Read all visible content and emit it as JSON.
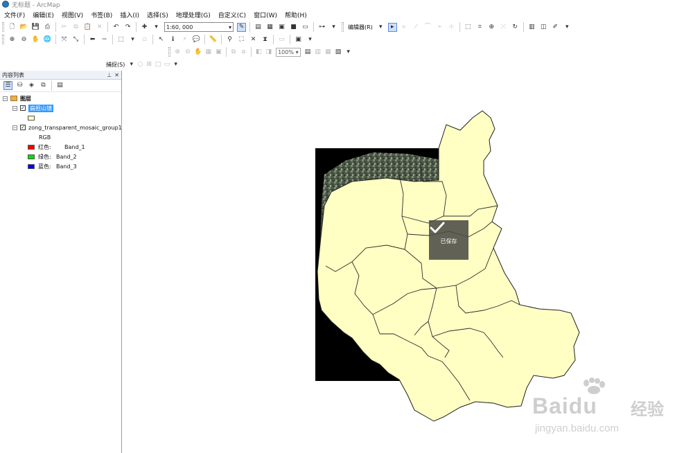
{
  "window": {
    "title": "无标题 - ArcMap"
  },
  "menu": [
    "文件(F)",
    "编辑(E)",
    "视图(V)",
    "书签(B)",
    "插入(I)",
    "选择(S)",
    "地理处理(G)",
    "自定义(C)",
    "窗口(W)",
    "帮助(H)"
  ],
  "standard_toolbar": {
    "scale": "1:60, 000",
    "editor_label": "编辑器(R)"
  },
  "layout_toolbar": {
    "zoom": "100%"
  },
  "snapping_toolbar": {
    "label": "捕捉(S)"
  },
  "toc": {
    "title": "内容列表",
    "root_label": "图层",
    "layers": [
      {
        "name": "扁担山镇",
        "checked": true,
        "selected": true,
        "symbol_color": "#ffffc4"
      },
      {
        "name": "zong_transparent_mosaic_group1",
        "checked": true,
        "selected": false,
        "render_label": "RGB",
        "bands": [
          {
            "channel": "红色:",
            "band": "Band_1",
            "color": "#ff0000"
          },
          {
            "channel": "绿色:",
            "band": "Band_2",
            "color": "#00e000"
          },
          {
            "channel": "蓝色:",
            "band": "Band_3",
            "color": "#0000ff"
          }
        ]
      }
    ]
  },
  "map": {
    "polygon_fill": "#ffffc4",
    "raster_background": "#000000"
  },
  "toast": {
    "label": "已保存"
  },
  "watermark": {
    "brand": "Baidu",
    "brand_cn": "经验",
    "url": "jingyan.baidu.com"
  }
}
